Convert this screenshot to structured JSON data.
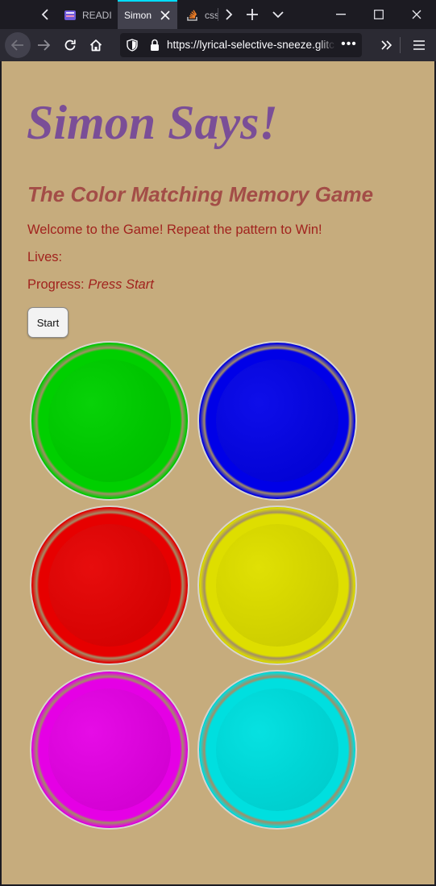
{
  "browser": {
    "tabs": [
      {
        "label": "READI",
        "icon": "readme-favicon-icon",
        "active": false
      },
      {
        "label": "Simon",
        "icon": "",
        "active": true
      },
      {
        "label": "css",
        "icon": "stackoverflow-favicon-icon",
        "active": false
      }
    ],
    "url_main": "https://lyrical-selective-sneeze.glit",
    "url_trailing": "c",
    "url_more": "•••"
  },
  "page": {
    "title": "Simon Says!",
    "subtitle": "The Color Matching Memory Game",
    "welcome": "Welcome to the Game! Repeat the pattern to Win!",
    "lives_label": "Lives:",
    "progress_label": "Progress:",
    "progress_value": "Press Start",
    "start_button": "Start",
    "buttons": [
      {
        "name": "green",
        "color": "#00cc00"
      },
      {
        "name": "blue",
        "color": "#0000dd"
      },
      {
        "name": "red",
        "color": "#dd0000"
      },
      {
        "name": "yellow",
        "color": "#dddd00"
      },
      {
        "name": "magenta",
        "color": "#dd00dd"
      },
      {
        "name": "cyan",
        "color": "#00dddd"
      }
    ]
  }
}
